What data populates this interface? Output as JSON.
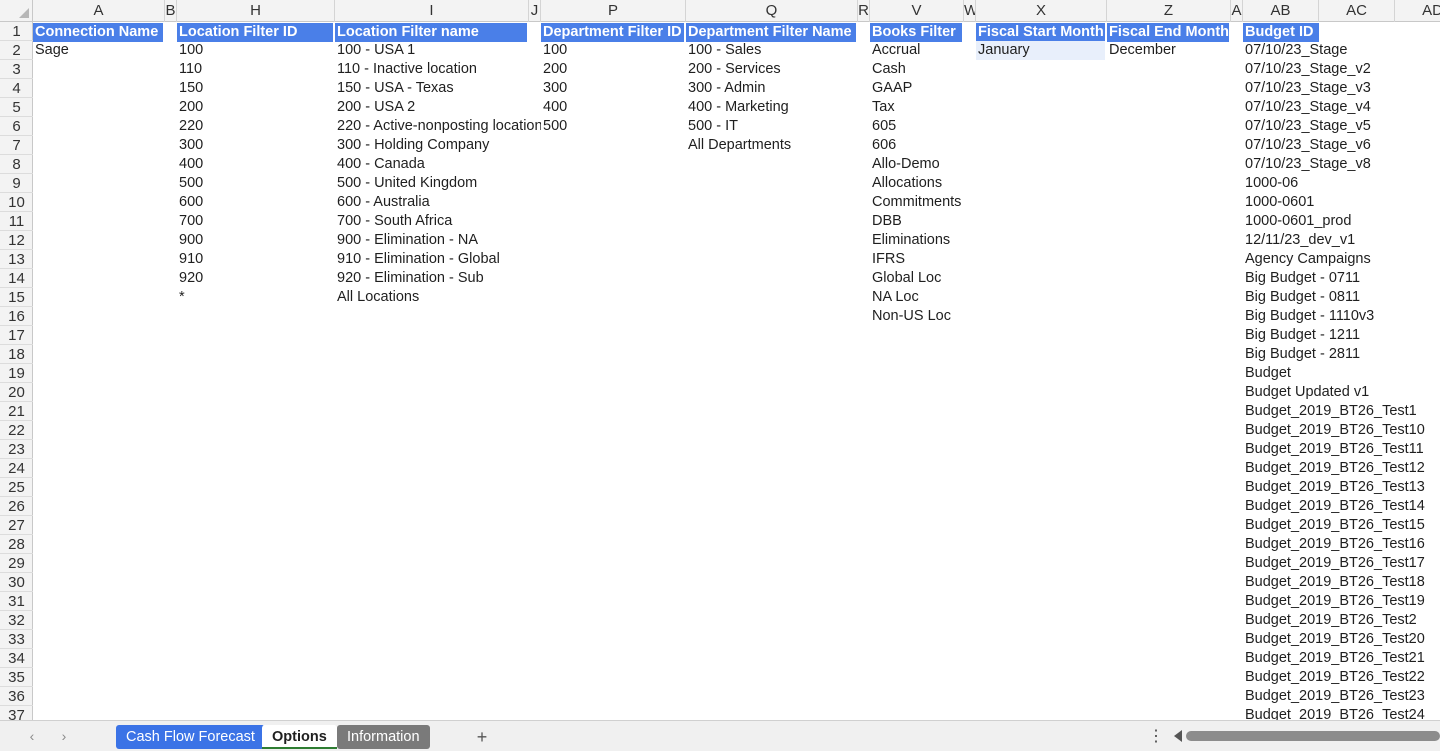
{
  "sheet": {
    "columns": [
      {
        "id": "A",
        "label": "A"
      },
      {
        "id": "B",
        "label": "B"
      },
      {
        "id": "H",
        "label": "H"
      },
      {
        "id": "I",
        "label": "I"
      },
      {
        "id": "J",
        "label": "J"
      },
      {
        "id": "P",
        "label": "P"
      },
      {
        "id": "Q",
        "label": "Q"
      },
      {
        "id": "R",
        "label": "R"
      },
      {
        "id": "V",
        "label": "V"
      },
      {
        "id": "W",
        "label": "W"
      },
      {
        "id": "X",
        "label": "X"
      },
      {
        "id": "Z",
        "label": "Z"
      },
      {
        "id": "AA",
        "label": "A"
      },
      {
        "id": "AB",
        "label": "AB"
      },
      {
        "id": "AC",
        "label": "AC"
      },
      {
        "id": "AD",
        "label": "AD"
      }
    ],
    "row_numbers": [
      "1",
      "2",
      "3",
      "4",
      "5",
      "6",
      "7",
      "8",
      "9",
      "10",
      "11",
      "12",
      "13",
      "14",
      "15",
      "16",
      "17",
      "18",
      "19",
      "20",
      "21",
      "22",
      "23",
      "24",
      "25",
      "26",
      "27",
      "28",
      "29",
      "30",
      "31",
      "32",
      "33",
      "34",
      "35",
      "36",
      "37"
    ],
    "header_color": "#4a7fe8",
    "headers": {
      "A": "Connection Name",
      "H": "Location Filter ID",
      "I": "Location Filter name",
      "P": "Department Filter ID",
      "Q": "Department Filter Name",
      "V": "Books Filter",
      "X": "Fiscal Start Month",
      "Z": "Fiscal End Month",
      "AB": "Budget ID"
    },
    "data": {
      "A": [
        "Sage"
      ],
      "H": [
        "100",
        "110",
        "150",
        "200",
        "220",
        "300",
        "400",
        "500",
        "600",
        "700",
        "900",
        "910",
        "920",
        "*"
      ],
      "I": [
        "100 - USA 1",
        "110 - Inactive location",
        "150 - USA - Texas",
        "200 - USA 2",
        "220 - Active-nonposting location",
        "300 - Holding Company",
        "400 - Canada",
        "500 - United Kingdom",
        "600 - Australia",
        "700 - South Africa",
        "900 - Elimination - NA",
        "910 - Elimination - Global",
        "920 - Elimination - Sub",
        "All Locations"
      ],
      "P": [
        "100",
        "200",
        "300",
        "400",
        "500"
      ],
      "Q": [
        "100 - Sales",
        "200 - Services",
        "300 - Admin",
        "400 - Marketing",
        "500 - IT",
        "All Departments"
      ],
      "V": [
        "Accrual",
        "Cash",
        "GAAP",
        "Tax",
        "605",
        "606",
        "Allo-Demo",
        "Allocations",
        "Commitments",
        "DBB",
        "Eliminations",
        "IFRS",
        "Global Loc",
        "NA Loc",
        "Non-US Loc"
      ],
      "X": [
        "January"
      ],
      "Z": [
        "December"
      ],
      "AB": [
        "07/10/23_Stage",
        "07/10/23_Stage_v2",
        "07/10/23_Stage_v3",
        "07/10/23_Stage_v4",
        "07/10/23_Stage_v5",
        "07/10/23_Stage_v6",
        "07/10/23_Stage_v8",
        "1000-06",
        "1000-0601",
        "1000-0601_prod",
        "12/11/23_dev_v1",
        "Agency Campaigns",
        "Big Budget - 0711",
        "Big Budget - 0811",
        "Big Budget - 1110v3",
        "Big Budget - 1211",
        "Big Budget - 2811",
        "Budget",
        "Budget Updated v1",
        "Budget_2019_BT26_Test1",
        "Budget_2019_BT26_Test10",
        "Budget_2019_BT26_Test11",
        "Budget_2019_BT26_Test12",
        "Budget_2019_BT26_Test13",
        "Budget_2019_BT26_Test14",
        "Budget_2019_BT26_Test15",
        "Budget_2019_BT26_Test16",
        "Budget_2019_BT26_Test17",
        "Budget_2019_BT26_Test18",
        "Budget_2019_BT26_Test19",
        "Budget_2019_BT26_Test2",
        "Budget_2019_BT26_Test20",
        "Budget_2019_BT26_Test21",
        "Budget_2019_BT26_Test22",
        "Budget_2019_BT26_Test23",
        "Budget_2019_BT26_Test24"
      ]
    },
    "selected_cell": "X2"
  },
  "tabs": {
    "nav_prev_icon": "‹",
    "nav_next_icon": "›",
    "items": [
      {
        "label": "Cash Flow Forecast",
        "color": "#3b73e6"
      },
      {
        "label": "Options",
        "color": "#ffffff"
      },
      {
        "label": "Information",
        "color": "#7a7a7a"
      }
    ],
    "add_icon": "+",
    "more_icon": "⋮"
  }
}
